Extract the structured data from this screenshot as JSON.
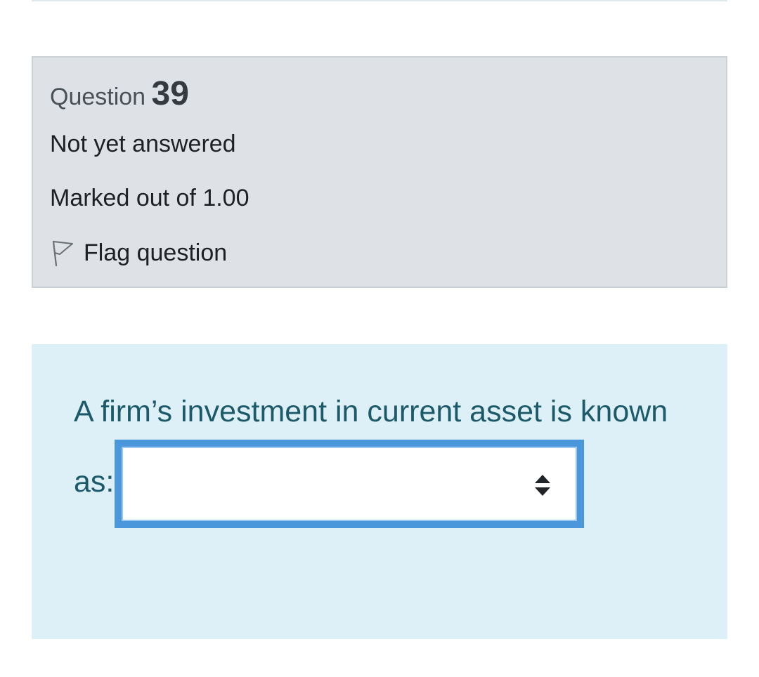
{
  "question_info": {
    "label": "Question",
    "number": "39",
    "state": "Not yet answered",
    "grade": "Marked out of 1.00",
    "flag_label": "Flag question"
  },
  "question": {
    "text_part1": "A firm’s investment in current asset is known",
    "text_part2": "as:",
    "select": {
      "selected_value": "",
      "icon": "up-down-chevron-icon"
    }
  },
  "colors": {
    "info_bg": "#dee2e6",
    "content_bg": "#def0f7",
    "question_text": "#1c5a69",
    "select_border": "#4a98db"
  }
}
